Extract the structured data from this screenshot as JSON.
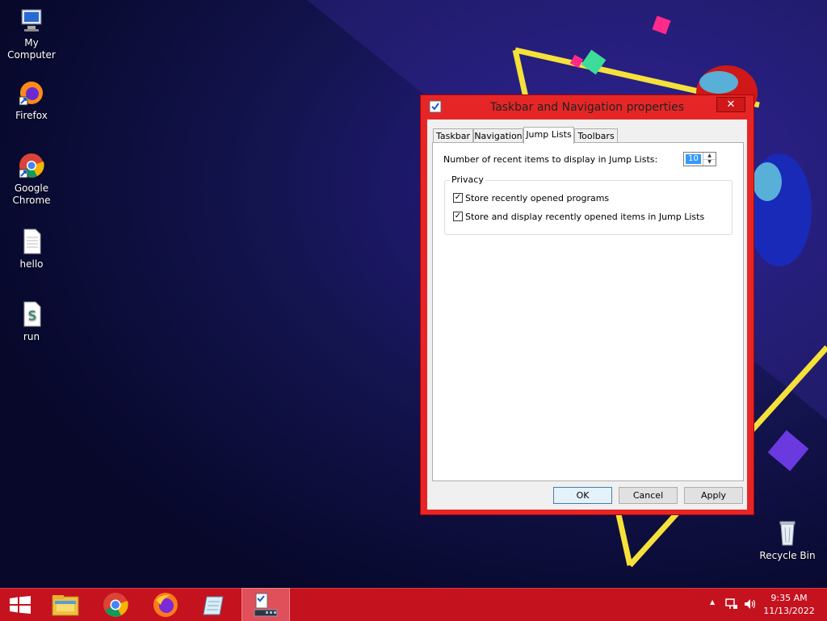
{
  "desktop": {
    "icons": [
      {
        "label": "My Computer",
        "icon": "computer-icon"
      },
      {
        "label": "Firefox",
        "icon": "firefox-icon"
      },
      {
        "label": "Google\nChrome",
        "icon": "chrome-icon"
      },
      {
        "label": "hello",
        "icon": "text-file-icon"
      },
      {
        "label": "run",
        "icon": "script-file-icon"
      },
      {
        "label": "Recycle Bin",
        "icon": "recycle-bin-icon"
      }
    ]
  },
  "dialog": {
    "title": "Taskbar and Navigation properties",
    "tabs": [
      {
        "label": "Taskbar"
      },
      {
        "label": "Navigation"
      },
      {
        "label": "Jump Lists",
        "selected": true
      },
      {
        "label": "Toolbars"
      }
    ],
    "recent_items_label": "Number of recent items to display in Jump Lists:",
    "recent_items_value": "10",
    "privacy": {
      "title": "Privacy",
      "options": [
        {
          "label": "Store recently opened programs",
          "checked": true
        },
        {
          "label": "Store and display recently opened items in Jump Lists",
          "checked": true
        }
      ]
    },
    "buttons": {
      "ok": "OK",
      "cancel": "Cancel",
      "apply": "Apply"
    }
  },
  "taskbar": {
    "apps": [
      {
        "icon": "windows-start-icon"
      },
      {
        "icon": "file-explorer-icon"
      },
      {
        "icon": "chrome-icon"
      },
      {
        "icon": "firefox-icon"
      },
      {
        "icon": "notepad-icon"
      },
      {
        "icon": "taskbar-properties-icon",
        "active": true
      }
    ],
    "tray": {
      "time": "9:35 AM",
      "date": "11/13/2022"
    }
  },
  "colors": {
    "taskbar": "#c4121e",
    "dialog_frame": "#e62626",
    "selection": "#3399ff"
  }
}
